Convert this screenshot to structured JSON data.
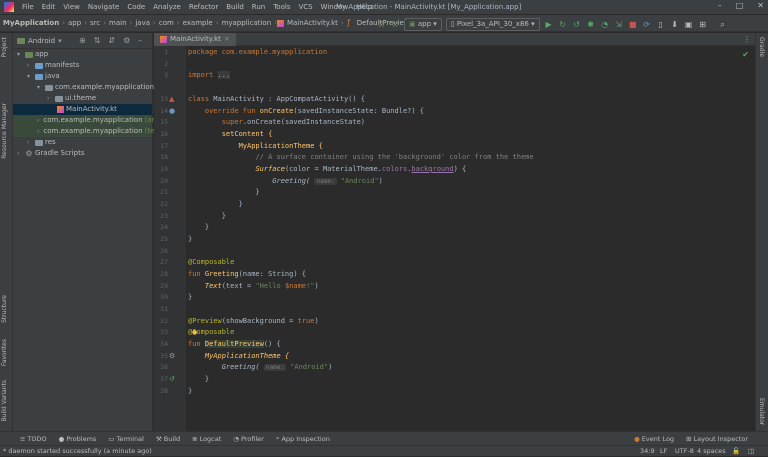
{
  "menu": [
    "File",
    "Edit",
    "View",
    "Navigate",
    "Code",
    "Analyze",
    "Refactor",
    "Build",
    "Run",
    "Tools",
    "VCS",
    "Window",
    "Help"
  ],
  "window_title": "My Application - MainActivity.kt [My_Application.app]",
  "breadcrumbs": [
    "MyApplication",
    "app",
    "src",
    "main",
    "java",
    "com",
    "example",
    "myapplication",
    "MainActivity.kt",
    "DefaultPreview()"
  ],
  "run_config": "app",
  "device": "Pixel_3a_API_30_x86",
  "project_panel": {
    "view_mode": "Android",
    "tree": [
      {
        "label": "app",
        "depth": 0,
        "type": "folder-blue",
        "expanded": true
      },
      {
        "label": "manifests",
        "depth": 1,
        "type": "folder-blue",
        "expanded": false
      },
      {
        "label": "java",
        "depth": 1,
        "type": "folder-blue",
        "expanded": true
      },
      {
        "label": "com.example.myapplication",
        "depth": 2,
        "type": "folder",
        "expanded": true
      },
      {
        "label": "ui.theme",
        "depth": 3,
        "type": "folder",
        "expanded": false
      },
      {
        "label": "MainActivity.kt",
        "depth": 3,
        "type": "kt",
        "selected": true
      },
      {
        "label": "com.example.myapplication",
        "suffix": "(androidTest)",
        "depth": 2,
        "type": "folder-green",
        "expanded": false
      },
      {
        "label": "com.example.myapplication",
        "suffix": "(test)",
        "depth": 2,
        "type": "folder-green",
        "expanded": false
      },
      {
        "label": "res",
        "depth": 1,
        "type": "folder",
        "expanded": false
      },
      {
        "label": "Gradle Scripts",
        "depth": 0,
        "type": "gradle",
        "expanded": false
      }
    ]
  },
  "left_tool_tabs": [
    "Project",
    "Resource Manager",
    "Structure",
    "Favorites",
    "Build Variants"
  ],
  "right_tool_tabs": [
    "Gradle",
    "Emulator"
  ],
  "editor_tab": "MainActivity.kt",
  "line_numbers": [
    "1",
    "2",
    "3",
    "",
    "13",
    "14",
    "15",
    "16",
    "17",
    "18",
    "19",
    "20",
    "21",
    "22",
    "23",
    "24",
    "25",
    "26",
    "27",
    "28",
    "29",
    "30",
    "31",
    "32",
    "33",
    "34",
    "35",
    "36",
    "37",
    "38"
  ],
  "code": {
    "l1": [
      "package com.example.myapplication"
    ],
    "l3_kw": "import",
    "l3_fold": "...",
    "l13": [
      "class ",
      "MainActivity",
      " : AppCompatActivity() {"
    ],
    "l14": [
      "override fun ",
      "onCreate",
      "(savedInstanceState: Bundle?) {"
    ],
    "l15": [
      "super",
      ".onCreate(savedInstanceState)"
    ],
    "l16": "setContent {",
    "l17": "MyApplicationTheme {",
    "l18": "// A surface container using the 'background' color from the theme",
    "l19": [
      "Surface",
      "(color = MaterialTheme.",
      "colors",
      ".",
      "background",
      ") {"
    ],
    "l20": [
      "Greeting(",
      "name:",
      "\"Android\"",
      ")"
    ],
    "l27": "@Composable",
    "l28": [
      "fun ",
      "Greeting",
      "(name: String) {"
    ],
    "l29": [
      "Text",
      "(text = ",
      "\"Hello ",
      "$name",
      "!\"",
      ")"
    ],
    "l32": [
      "@Preview",
      "(showBackground = ",
      "true",
      ")"
    ],
    "l33": "@Composable",
    "l34": [
      "fun ",
      "DefaultPreview",
      "() {"
    ],
    "l35": "MyApplicationTheme {",
    "l36": [
      "Greeting(",
      "name:",
      "\"Android\"",
      ")"
    ]
  },
  "bottom_tabs": [
    "TODO",
    "Problems",
    "Terminal",
    "Build",
    "Logcat",
    "Profiler",
    "App Inspection"
  ],
  "bottom_right_tabs": [
    "Event Log",
    "Layout Inspector"
  ],
  "status_message": "* daemon started successfully (a minute ago)",
  "status_right": [
    "34:9",
    "LF",
    "UTF-8",
    "4 spaces"
  ]
}
